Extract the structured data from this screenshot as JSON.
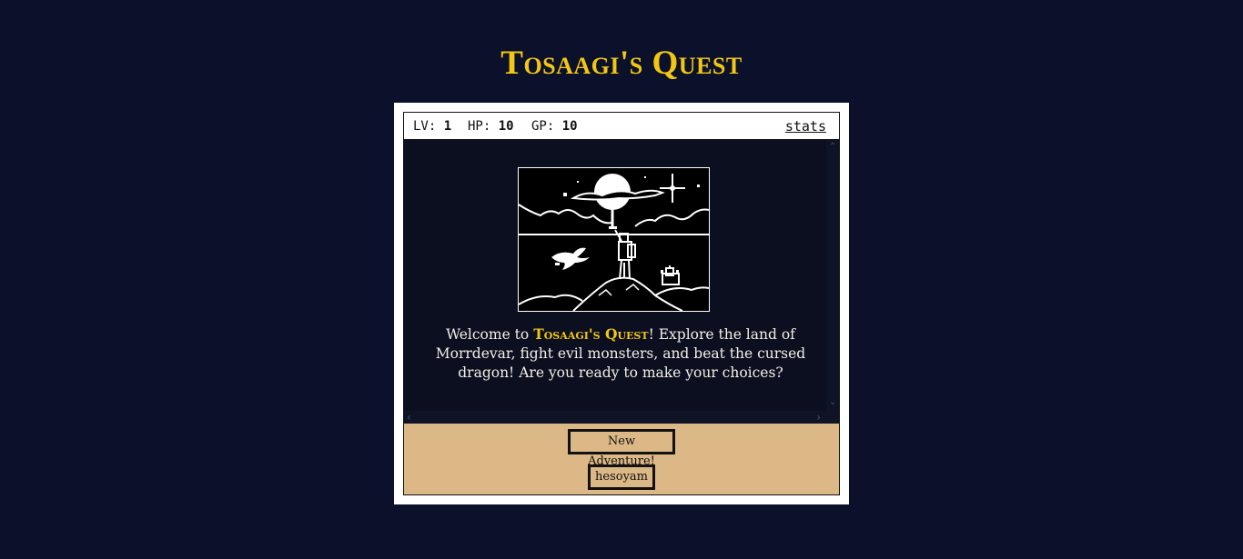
{
  "title": {
    "text": "Tosaagi's Quest",
    "color": "#f2c713"
  },
  "statusbar": {
    "lv_label": "LV:",
    "lv_value": "1",
    "hp_label": "HP:",
    "hp_value": "10",
    "gp_label": "GP:",
    "gp_value": "10",
    "stats_link": "stats"
  },
  "story": {
    "intro_before": "Welcome to ",
    "intro_game_name": "Tosaagi's Quest",
    "intro_after": "! Explore the land of Morrdevar, fight evil monsters, and beat the cursed dragon! Are you ready to make your choices?",
    "scene_icon": "hero-on-mountain-pixel-art"
  },
  "choices": [
    {
      "label": "New Adventure!"
    },
    {
      "label": "hesoyam"
    }
  ],
  "colors": {
    "page_background": "#0b102b",
    "story_background": "#0b0f20",
    "choices_background": "#dcb887",
    "accent": "#f2c713"
  }
}
